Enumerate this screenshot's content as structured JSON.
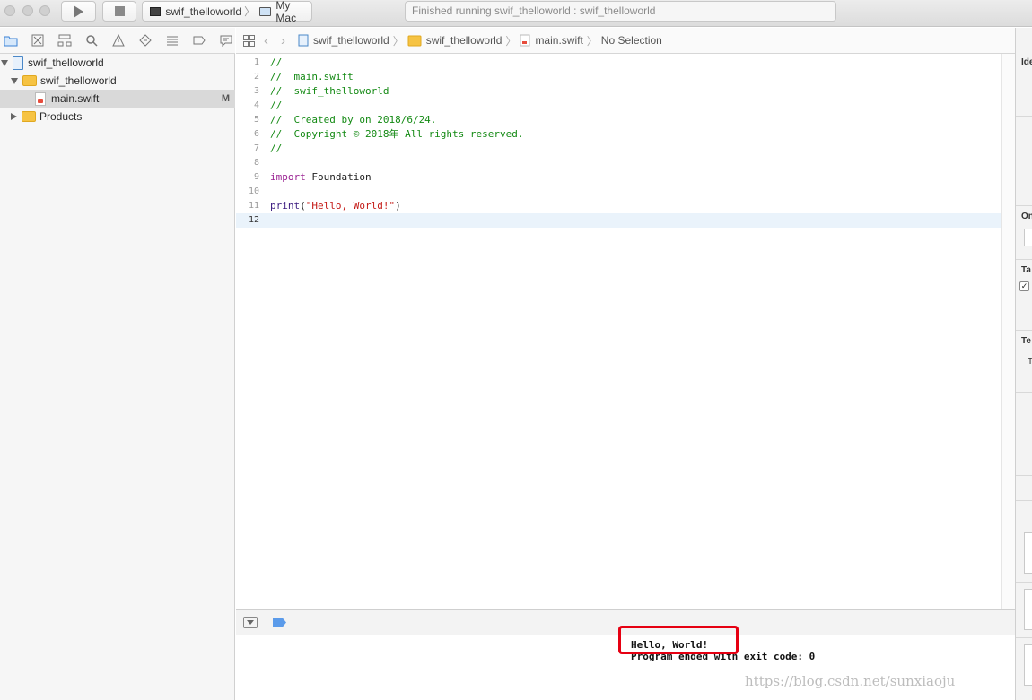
{
  "toolbar": {
    "scheme_name": "swif_thelloworld",
    "destination": "My Mac",
    "status": "Finished running swif_thelloworld : swif_thelloworld"
  },
  "navigator": {
    "items": [
      {
        "label": "swif_thelloworld",
        "icon": "project-icon"
      },
      {
        "label": "swif_thelloworld",
        "icon": "folder-icon"
      },
      {
        "label": "main.swift",
        "icon": "swift-file-icon",
        "badge": "M"
      },
      {
        "label": "Products",
        "icon": "folder-icon"
      }
    ]
  },
  "jumpbar": {
    "project": "swif_thelloworld",
    "group": "swif_thelloworld",
    "file": "main.swift",
    "selection": "No Selection"
  },
  "editor": {
    "lines": [
      {
        "num": "1",
        "text": "//"
      },
      {
        "num": "2",
        "text": "//  main.swift"
      },
      {
        "num": "3",
        "text": "//  swif_thelloworld"
      },
      {
        "num": "4",
        "text": "//"
      },
      {
        "num": "5",
        "text": "//  Created by on 2018/6/24."
      },
      {
        "num": "6",
        "text": "//  Copyright © 2018年 All rights reserved."
      },
      {
        "num": "7",
        "text": "//"
      },
      {
        "num": "8",
        "text": ""
      },
      {
        "num": "9",
        "kw": "import",
        "rest": " Foundation"
      },
      {
        "num": "10",
        "text": ""
      },
      {
        "num": "11",
        "fn": "print",
        "p1": "(",
        "str": "\"Hello, World!\"",
        "p2": ")"
      },
      {
        "num": "12",
        "text": ""
      }
    ]
  },
  "console": {
    "line1": "Hello, World!",
    "line2": "Program ended with exit code: 0"
  },
  "watermark": "https://blog.csdn.net/sunxiaoju",
  "inspector": {
    "sections": [
      "Ide",
      "On",
      "Ta",
      "Te"
    ],
    "small_label": "T"
  }
}
